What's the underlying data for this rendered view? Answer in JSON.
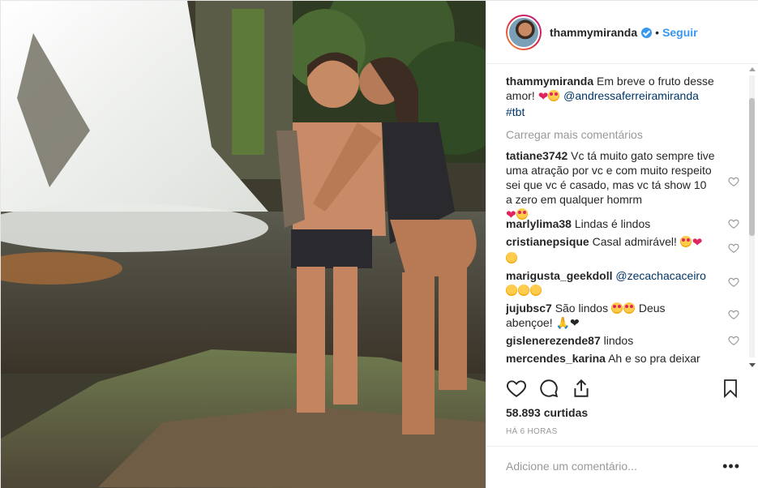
{
  "header": {
    "username": "thammymiranda",
    "separator": "•",
    "follow_label": "Seguir"
  },
  "caption": {
    "username": "thammymiranda",
    "text": "Em breve o fruto desse amor!",
    "mention": "@andressaferreiramiranda",
    "tag": "#tbt"
  },
  "load_more": "Carregar mais comentários",
  "comments": [
    {
      "username": "tatiane3742",
      "text": "Vc tá muito gato sempre tive uma atração por vc e com muito respeito sei que vc é casado, mas vc tá show 10 a zero em qualquer homrm"
    },
    {
      "username": "marlylima38",
      "text": "Lindas é lindos"
    },
    {
      "username": "cristianepsique",
      "text": "Casal admirável!"
    },
    {
      "username": "marigusta_geekdoll",
      "text": "@zecachacaceiro"
    },
    {
      "username": "jujubsc7",
      "text": "São lindos",
      "text2": "Deus abençoe!"
    },
    {
      "username": "gislenerezende87",
      "text": "lindos"
    },
    {
      "username": "mercendes_karina",
      "text": "Ah e so pra deixar"
    }
  ],
  "likes": "58.893 curtidas",
  "time": "HÁ 6 HORAS",
  "add_comment_placeholder": "Adicione um comentário...",
  "more_label": "•••",
  "colors": {
    "accent": "#3897f0",
    "text": "#262626",
    "muted": "#999999",
    "mention": "#003569"
  },
  "icons": [
    "verified-badge-icon",
    "heart-icon",
    "comment-icon",
    "share-icon",
    "bookmark-icon",
    "more-options-icon"
  ]
}
